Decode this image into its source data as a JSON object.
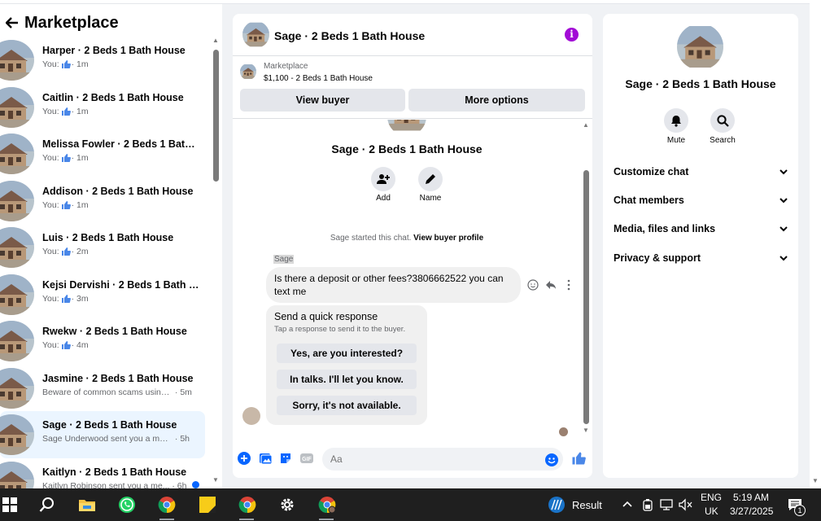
{
  "sidebar": {
    "title": "Marketplace",
    "conversations": [
      {
        "name": "Harper · 2 Beds 1 Bath House",
        "preview": "You:",
        "time": "· 1m",
        "thumb": true
      },
      {
        "name": "Caitlin · 2 Beds 1 Bath House",
        "preview": "You:",
        "time": "· 1m",
        "thumb": true
      },
      {
        "name": "Melissa Fowler · 2 Beds 1 Bath ...",
        "preview": "You:",
        "time": "· 1m",
        "thumb": true
      },
      {
        "name": "Addison · 2 Beds 1 Bath House",
        "preview": "You:",
        "time": "· 1m",
        "thumb": true
      },
      {
        "name": "Luis · 2 Beds 1 Bath House",
        "preview": "You:",
        "time": "· 2m",
        "thumb": true
      },
      {
        "name": "Kejsi Dervishi · 2 Beds 1 Bath H...",
        "preview": "You:",
        "time": "· 3m",
        "thumb": true
      },
      {
        "name": "Rwekw · 2 Beds 1 Bath House",
        "preview": "You:",
        "time": "· 4m",
        "thumb": true
      },
      {
        "name": "Jasmine · 2 Beds 1 Bath House",
        "preview": "Beware of common scams using ...",
        "time": "· 5m",
        "thumb": false
      },
      {
        "name": "Sage · 2 Beds 1 Bath House",
        "preview": "Sage Underwood sent you a mess...",
        "time": "· 5h",
        "thumb": false
      },
      {
        "name": "Kaitlyn · 2 Beds 1 Bath House",
        "preview": "Kaitlyn Robinson sent you a me...",
        "time": "· 6h",
        "thumb": false
      }
    ]
  },
  "chat": {
    "title": "Sage · 2 Beds 1 Bath House",
    "marketplace_label": "Marketplace",
    "listing": "$1,100 - 2 Beds 1 Bath House",
    "view_buyer": "View buyer",
    "more_options": "More options",
    "intro_name": "Sage · 2 Beds 1 Bath House",
    "add_label": "Add",
    "name_label": "Name",
    "started_text": "Sage started this chat.",
    "view_profile": "View buyer profile",
    "sender": "Sage",
    "message": "Is there a deposit or other fees?3806662522 you can text me",
    "quick_title": "Send a quick response",
    "quick_sub": "Tap a response to send it to the buyer.",
    "quick_responses": [
      "Yes, are you interested?",
      "In talks. I'll let you know.",
      "Sorry, it's not available."
    ],
    "input_placeholder": "Aa"
  },
  "details": {
    "title": "Sage · 2 Beds 1 Bath House",
    "mute": "Mute",
    "search": "Search",
    "sections": [
      "Customize chat",
      "Chat members",
      "Media, files and links",
      "Privacy & support"
    ]
  },
  "taskbar": {
    "weather": "Result",
    "lang1": "ENG",
    "lang2": "UK",
    "time": "5:19 AM",
    "date": "3/27/2025",
    "notif_count": "1"
  },
  "colors": {
    "accent": "#0866ff",
    "info": "#a20bd6",
    "active_row": "#ebf5ff"
  }
}
